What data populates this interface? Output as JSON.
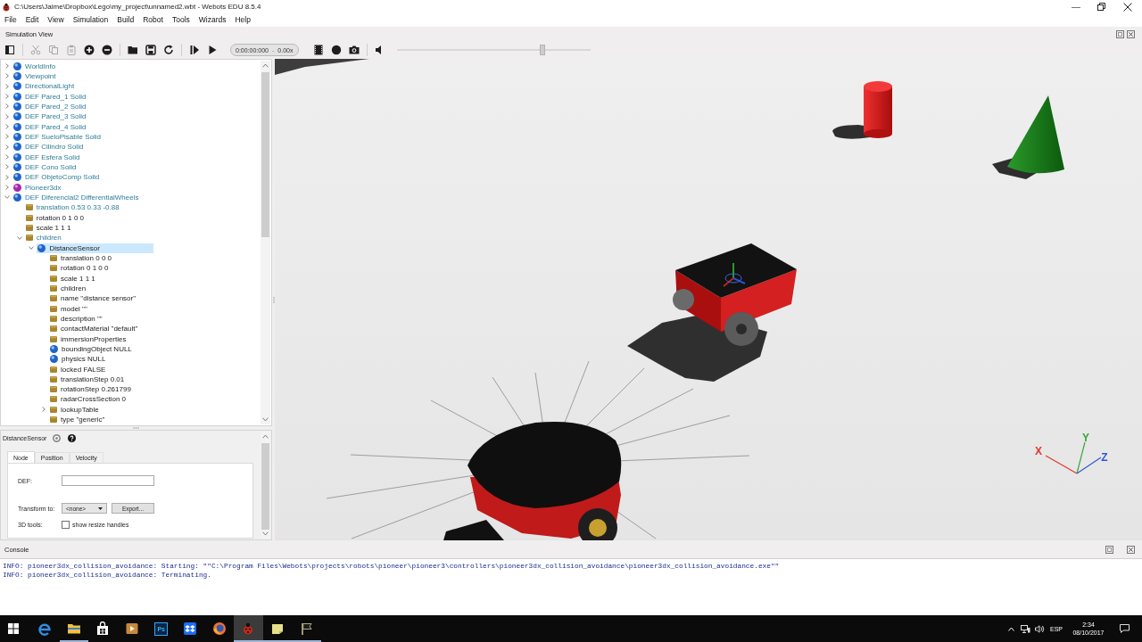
{
  "window": {
    "title": "C:\\Users\\Jaime\\Dropbox\\Lego\\my_project\\unnamed2.wbt - Webots EDU 8.5.4"
  },
  "menu": [
    "File",
    "Edit",
    "View",
    "Simulation",
    "Build",
    "Robot",
    "Tools",
    "Wizards",
    "Help"
  ],
  "simulation_view": {
    "title": "Simulation View",
    "toolbar": {
      "groups": [
        [
          {
            "kind": "panel",
            "disabled": false
          }
        ],
        [
          {
            "kind": "cut",
            "disabled": true
          },
          {
            "kind": "copy",
            "disabled": true
          },
          {
            "kind": "paste",
            "disabled": true
          },
          {
            "kind": "add",
            "disabled": false
          },
          {
            "kind": "remove",
            "disabled": false
          }
        ],
        [
          {
            "kind": "open",
            "disabled": false
          },
          {
            "kind": "save",
            "disabled": false
          },
          {
            "kind": "reload",
            "disabled": false
          }
        ],
        [
          {
            "kind": "step",
            "disabled": false
          },
          {
            "kind": "run",
            "disabled": false
          }
        ]
      ],
      "clock": {
        "time": "0:00:00:000",
        "separator": "-",
        "speed": "0.00x"
      },
      "media_tools": [
        {
          "kind": "movie"
        },
        {
          "kind": "record"
        },
        {
          "kind": "screenshot"
        }
      ],
      "volume": {
        "level": 0.75
      }
    }
  },
  "scene_tree": {
    "items": [
      {
        "label": "WorldInfo",
        "kind": "node",
        "modified": true,
        "expanded": false,
        "selected": false
      },
      {
        "label": "Viewpoint",
        "kind": "node",
        "modified": true,
        "expanded": false,
        "selected": false
      },
      {
        "label": "DirectionalLight",
        "kind": "node",
        "modified": true,
        "expanded": false,
        "selected": false
      },
      {
        "label": "DEF Pared_1 Solid",
        "kind": "node",
        "modified": true,
        "expanded": false,
        "selected": false
      },
      {
        "label": "DEF Pared_2 Solid",
        "kind": "node",
        "modified": true,
        "expanded": false,
        "selected": false
      },
      {
        "label": "DEF Pared_3 Solid",
        "kind": "node",
        "modified": true,
        "expanded": false,
        "selected": false
      },
      {
        "label": "DEF Pared_4 Solid",
        "kind": "node",
        "modified": true,
        "expanded": false,
        "selected": false
      },
      {
        "label": "DEF SueloPisable Solid",
        "kind": "node",
        "modified": true,
        "expanded": false,
        "selected": false
      },
      {
        "label": "DEF Cilindro Solid",
        "kind": "node",
        "modified": true,
        "expanded": false,
        "selected": false
      },
      {
        "label": "DEF Esfera Solid",
        "kind": "node",
        "modified": true,
        "expanded": false,
        "selected": false
      },
      {
        "label": "DEF Cono Solid",
        "kind": "node",
        "modified": true,
        "expanded": false,
        "selected": false
      },
      {
        "label": "DEF ObjetoComp Solid",
        "kind": "node",
        "modified": true,
        "expanded": false,
        "selected": false
      },
      {
        "label": "Pioneer3dx",
        "kind": "robot",
        "modified": true,
        "expanded": false,
        "selected": false
      },
      {
        "label": "DEF Diferencial2 DifferentialWheels",
        "kind": "node",
        "modified": true,
        "expanded": true,
        "selected": false,
        "children": [
          {
            "label": "translation 0.53 0.33 -0.88",
            "kind": "field",
            "modified": true,
            "selected": false
          },
          {
            "label": "rotation 0 1 0 0",
            "kind": "field",
            "modified": false,
            "selected": false
          },
          {
            "label": "scale 1 1 1",
            "kind": "field",
            "modified": false,
            "selected": false
          },
          {
            "label": "children",
            "kind": "field",
            "modified": true,
            "expanded": true,
            "selected": false,
            "children": [
              {
                "label": "DistanceSensor",
                "kind": "node",
                "modified": false,
                "expanded": true,
                "selected": true,
                "children": [
                  {
                    "label": "translation 0 0 0",
                    "kind": "field",
                    "modified": false,
                    "selected": false
                  },
                  {
                    "label": "rotation 0 1 0 0",
                    "kind": "field",
                    "modified": false,
                    "selected": false
                  },
                  {
                    "label": "scale 1 1 1",
                    "kind": "field",
                    "modified": false,
                    "selected": false
                  },
                  {
                    "label": "children",
                    "kind": "field",
                    "modified": false,
                    "selected": false
                  },
                  {
                    "label": "name \"distance sensor\"",
                    "kind": "field",
                    "modified": false,
                    "selected": false
                  },
                  {
                    "label": "model \"\"",
                    "kind": "field",
                    "modified": false,
                    "selected": false
                  },
                  {
                    "label": "description \"\"",
                    "kind": "field",
                    "modified": false,
                    "selected": false
                  },
                  {
                    "label": "contactMaterial \"default\"",
                    "kind": "field",
                    "modified": false,
                    "selected": false
                  },
                  {
                    "label": "immersionProperties",
                    "kind": "field",
                    "modified": false,
                    "selected": false
                  },
                  {
                    "label": "boundingObject NULL",
                    "kind": "node",
                    "modified": false,
                    "selected": false
                  },
                  {
                    "label": "physics NULL",
                    "kind": "node",
                    "modified": false,
                    "selected": false
                  },
                  {
                    "label": "locked FALSE",
                    "kind": "field",
                    "modified": false,
                    "selected": false
                  },
                  {
                    "label": "translationStep 0.01",
                    "kind": "field",
                    "modified": false,
                    "selected": false
                  },
                  {
                    "label": "rotationStep 0.261799",
                    "kind": "field",
                    "modified": false,
                    "selected": false
                  },
                  {
                    "label": "radarCrossSection 0",
                    "kind": "field",
                    "modified": false,
                    "selected": false
                  },
                  {
                    "label": "lookupTable",
                    "kind": "field",
                    "modified": false,
                    "expanded": false,
                    "selected": false
                  },
                  {
                    "label": "type \"generic\"",
                    "kind": "field",
                    "modified": false,
                    "selected": false
                  }
                ]
              }
            ]
          }
        ]
      }
    ]
  },
  "node_panel": {
    "title": "DistanceSensor",
    "tabs": [
      {
        "label": "Node",
        "selected": true
      },
      {
        "label": "Position",
        "selected": false
      },
      {
        "label": "Velocity",
        "selected": false
      }
    ],
    "def": {
      "label": "DEF:"
    },
    "transform": {
      "label": "Transform to:",
      "value": "<none>",
      "button": "Export..."
    },
    "tools": {
      "label": "3D tools:",
      "option": "show resize handles",
      "checked": false
    }
  },
  "viewport": {
    "axes": [
      {
        "label": "X",
        "color": "#e8352b"
      },
      {
        "label": "Y",
        "color": "#3aa53a"
      },
      {
        "label": "Z",
        "color": "#2f55d6"
      }
    ]
  },
  "console": {
    "title": "Console",
    "lines": [
      "INFO: pioneer3dx_collision_avoidance: Starting: \"\"C:\\Program Files\\Webots\\projects\\robots\\pioneer\\pioneer3\\controllers\\pioneer3dx_collision_avoidance\\pioneer3dx_collision_avoidance.exe\"\"",
      "INFO: pioneer3dx_collision_avoidance: Terminating."
    ]
  },
  "taskbar": {
    "apps": [
      {
        "kind": "browser",
        "running": false,
        "selected": false
      },
      {
        "kind": "folder",
        "running": true,
        "selected": false
      },
      {
        "kind": "bag",
        "running": false,
        "selected": false
      },
      {
        "kind": "player",
        "running": false,
        "selected": false
      },
      {
        "kind": "tile",
        "label": "Ps",
        "running": false,
        "selected": false
      },
      {
        "kind": "boxes",
        "running": false,
        "selected": false
      },
      {
        "kind": "globe",
        "running": false,
        "selected": false
      },
      {
        "kind": "bug",
        "running": true,
        "selected": true
      },
      {
        "kind": "note",
        "running": true,
        "selected": false
      },
      {
        "kind": "flag",
        "running": true,
        "selected": false
      }
    ],
    "tray": {
      "language": "ESP",
      "time": "2:34",
      "date": "08/10/2017"
    }
  }
}
